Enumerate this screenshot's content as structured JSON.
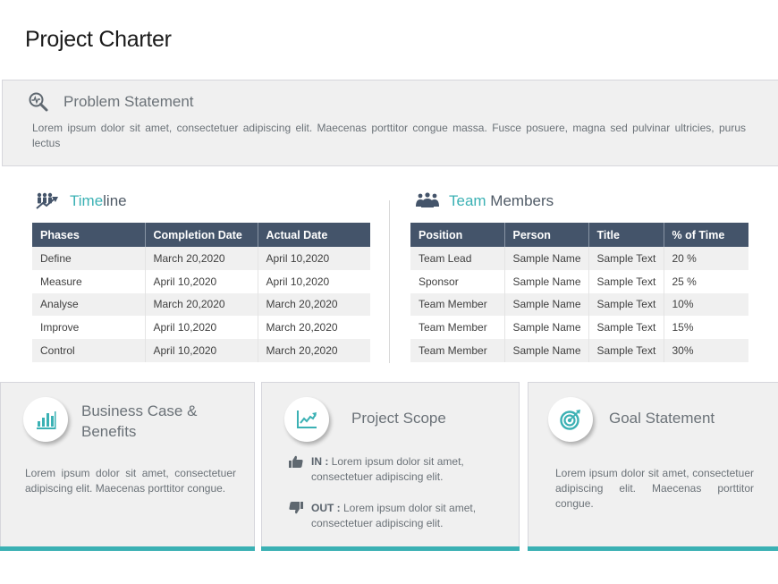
{
  "page": {
    "title": "Project Charter"
  },
  "problem_statement": {
    "icon": "magnifier-pulse-icon",
    "title": "Problem Statement",
    "body": "Lorem ipsum dolor sit amet, consectetuer adipiscing elit. Maecenas porttitor congue massa. Fusce posuere, magna sed pulvinar ultricies, purus lectus"
  },
  "timeline": {
    "icon": "people-growth-icon",
    "title_accent": "Time",
    "title_rest": "line",
    "columns": [
      "Phases",
      "Completion Date",
      "Actual Date"
    ],
    "rows": [
      [
        "Define",
        "March 20,2020",
        "April 10,2020"
      ],
      [
        "Measure",
        "April 10,2020",
        "April 10,2020"
      ],
      [
        "Analyse",
        "March 20,2020",
        "March 20,2020"
      ],
      [
        "Improve",
        "April 10,2020",
        "March 20,2020"
      ],
      [
        "Control",
        "April 10,2020",
        "March 20,2020"
      ]
    ]
  },
  "team_members": {
    "icon": "team-icon",
    "title_accent": "Team",
    "title_rest": " Members",
    "columns": [
      "Position",
      "Person",
      "Title",
      "% of Time"
    ],
    "rows": [
      [
        "Team Lead",
        "Sample Name",
        "Sample Text",
        "20 %"
      ],
      [
        "Sponsor",
        "Sample Name",
        "Sample Text",
        "25 %"
      ],
      [
        "Team Member",
        "Sample Name",
        "Sample Text",
        "10%"
      ],
      [
        "Team Member",
        "Sample Name",
        "Sample Text",
        "15%"
      ],
      [
        "Team Member",
        "Sample Name",
        "Sample Text",
        "30%"
      ]
    ]
  },
  "cards": {
    "business_case": {
      "icon": "bar-chart-icon",
      "title": "Business Case & Benefits",
      "body": "Lorem ipsum dolor sit amet, consectetuer adipiscing elit. Maecenas porttitor congue."
    },
    "project_scope": {
      "icon": "line-chart-icon",
      "title": "Project Scope",
      "in_label": "IN :",
      "in_text": " Lorem ipsum dolor sit amet, consectetuer adipiscing elit.",
      "out_label": "OUT :",
      "out_text": " Lorem ipsum dolor sit amet, consectetuer adipiscing elit."
    },
    "goal_statement": {
      "icon": "target-icon",
      "title": "Goal Statement",
      "body": "Lorem ipsum dolor sit amet, consectetuer adipiscing elit. Maecenas porttitor congue."
    }
  },
  "colors": {
    "accent": "#3bb1b4",
    "header": "#44546a",
    "panel": "#f0f0f0"
  }
}
